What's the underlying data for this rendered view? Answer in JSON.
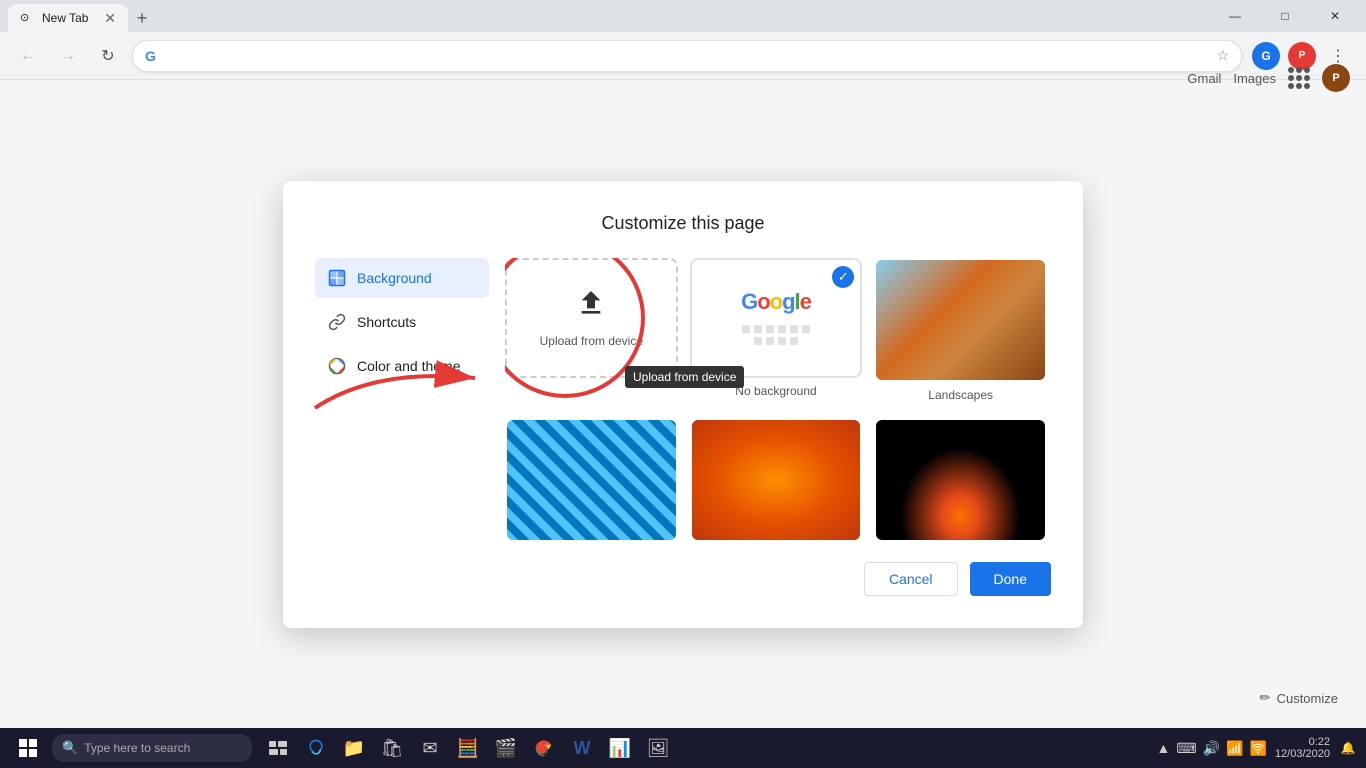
{
  "titlebar": {
    "tab_label": "New Tab",
    "new_tab_icon": "+",
    "minimize": "—",
    "maximize": "□",
    "close": "✕"
  },
  "navbar": {
    "back_icon": "←",
    "forward_icon": "→",
    "refresh_icon": "↻",
    "omnibox_placeholder": "",
    "star_icon": "☆",
    "google_sync_icon": "G",
    "extension_label": "P",
    "more_icon": "⋮"
  },
  "top_right": {
    "gmail": "Gmail",
    "images": "Images",
    "user_initial": "P"
  },
  "dialog": {
    "title": "Customize this page",
    "sidebar": {
      "background": "Background",
      "shortcuts": "Shortcuts",
      "color_and_theme": "Color and theme"
    },
    "grid": {
      "upload_label": "Upload from device",
      "no_background_label": "No background",
      "landscapes_label": "Landscapes"
    },
    "footer": {
      "cancel": "Cancel",
      "done": "Done"
    },
    "tooltip": "Upload from device"
  },
  "customize_btn": "✏ Customize",
  "taskbar": {
    "search_placeholder": "Type here to search",
    "clock": "0:22",
    "date": "12/03/2020"
  }
}
